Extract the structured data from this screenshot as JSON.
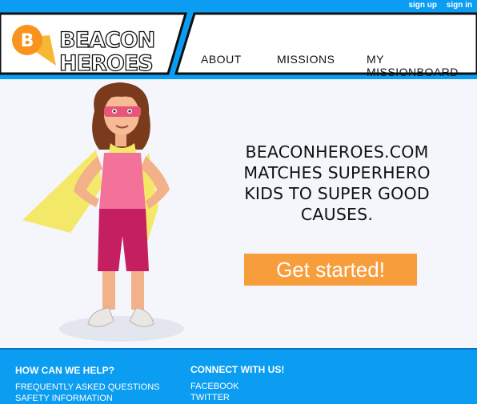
{
  "topbar": {
    "signup": "sign up",
    "signin": "sign in"
  },
  "logo": {
    "badge_letter": "B",
    "line1": "BEACON",
    "line2": "HEROES"
  },
  "nav": {
    "about": "ABOUT",
    "missions": "MISSIONS",
    "missionboard": "MY MISSIONBOARD"
  },
  "hero": {
    "title_lines": [
      "BEACONHEROES.COM",
      "MATCHES SUPERHERO",
      "KIDS TO SUPER GOOD",
      "CAUSES."
    ],
    "cta": "Get started!"
  },
  "footer": {
    "help_heading": "HOW CAN WE HELP?",
    "help_links": [
      "FREQUENTLY ASKED QUESTIONS",
      "SAFETY INFORMATION"
    ],
    "connect_heading": "CONNECT WITH US!",
    "connect_links": [
      "FACEBOOK",
      "TWITTER"
    ]
  },
  "colors": {
    "brand_blue": "#0b9df2",
    "cta_orange": "#f89d3c",
    "logo_orange": "#f7931e"
  }
}
